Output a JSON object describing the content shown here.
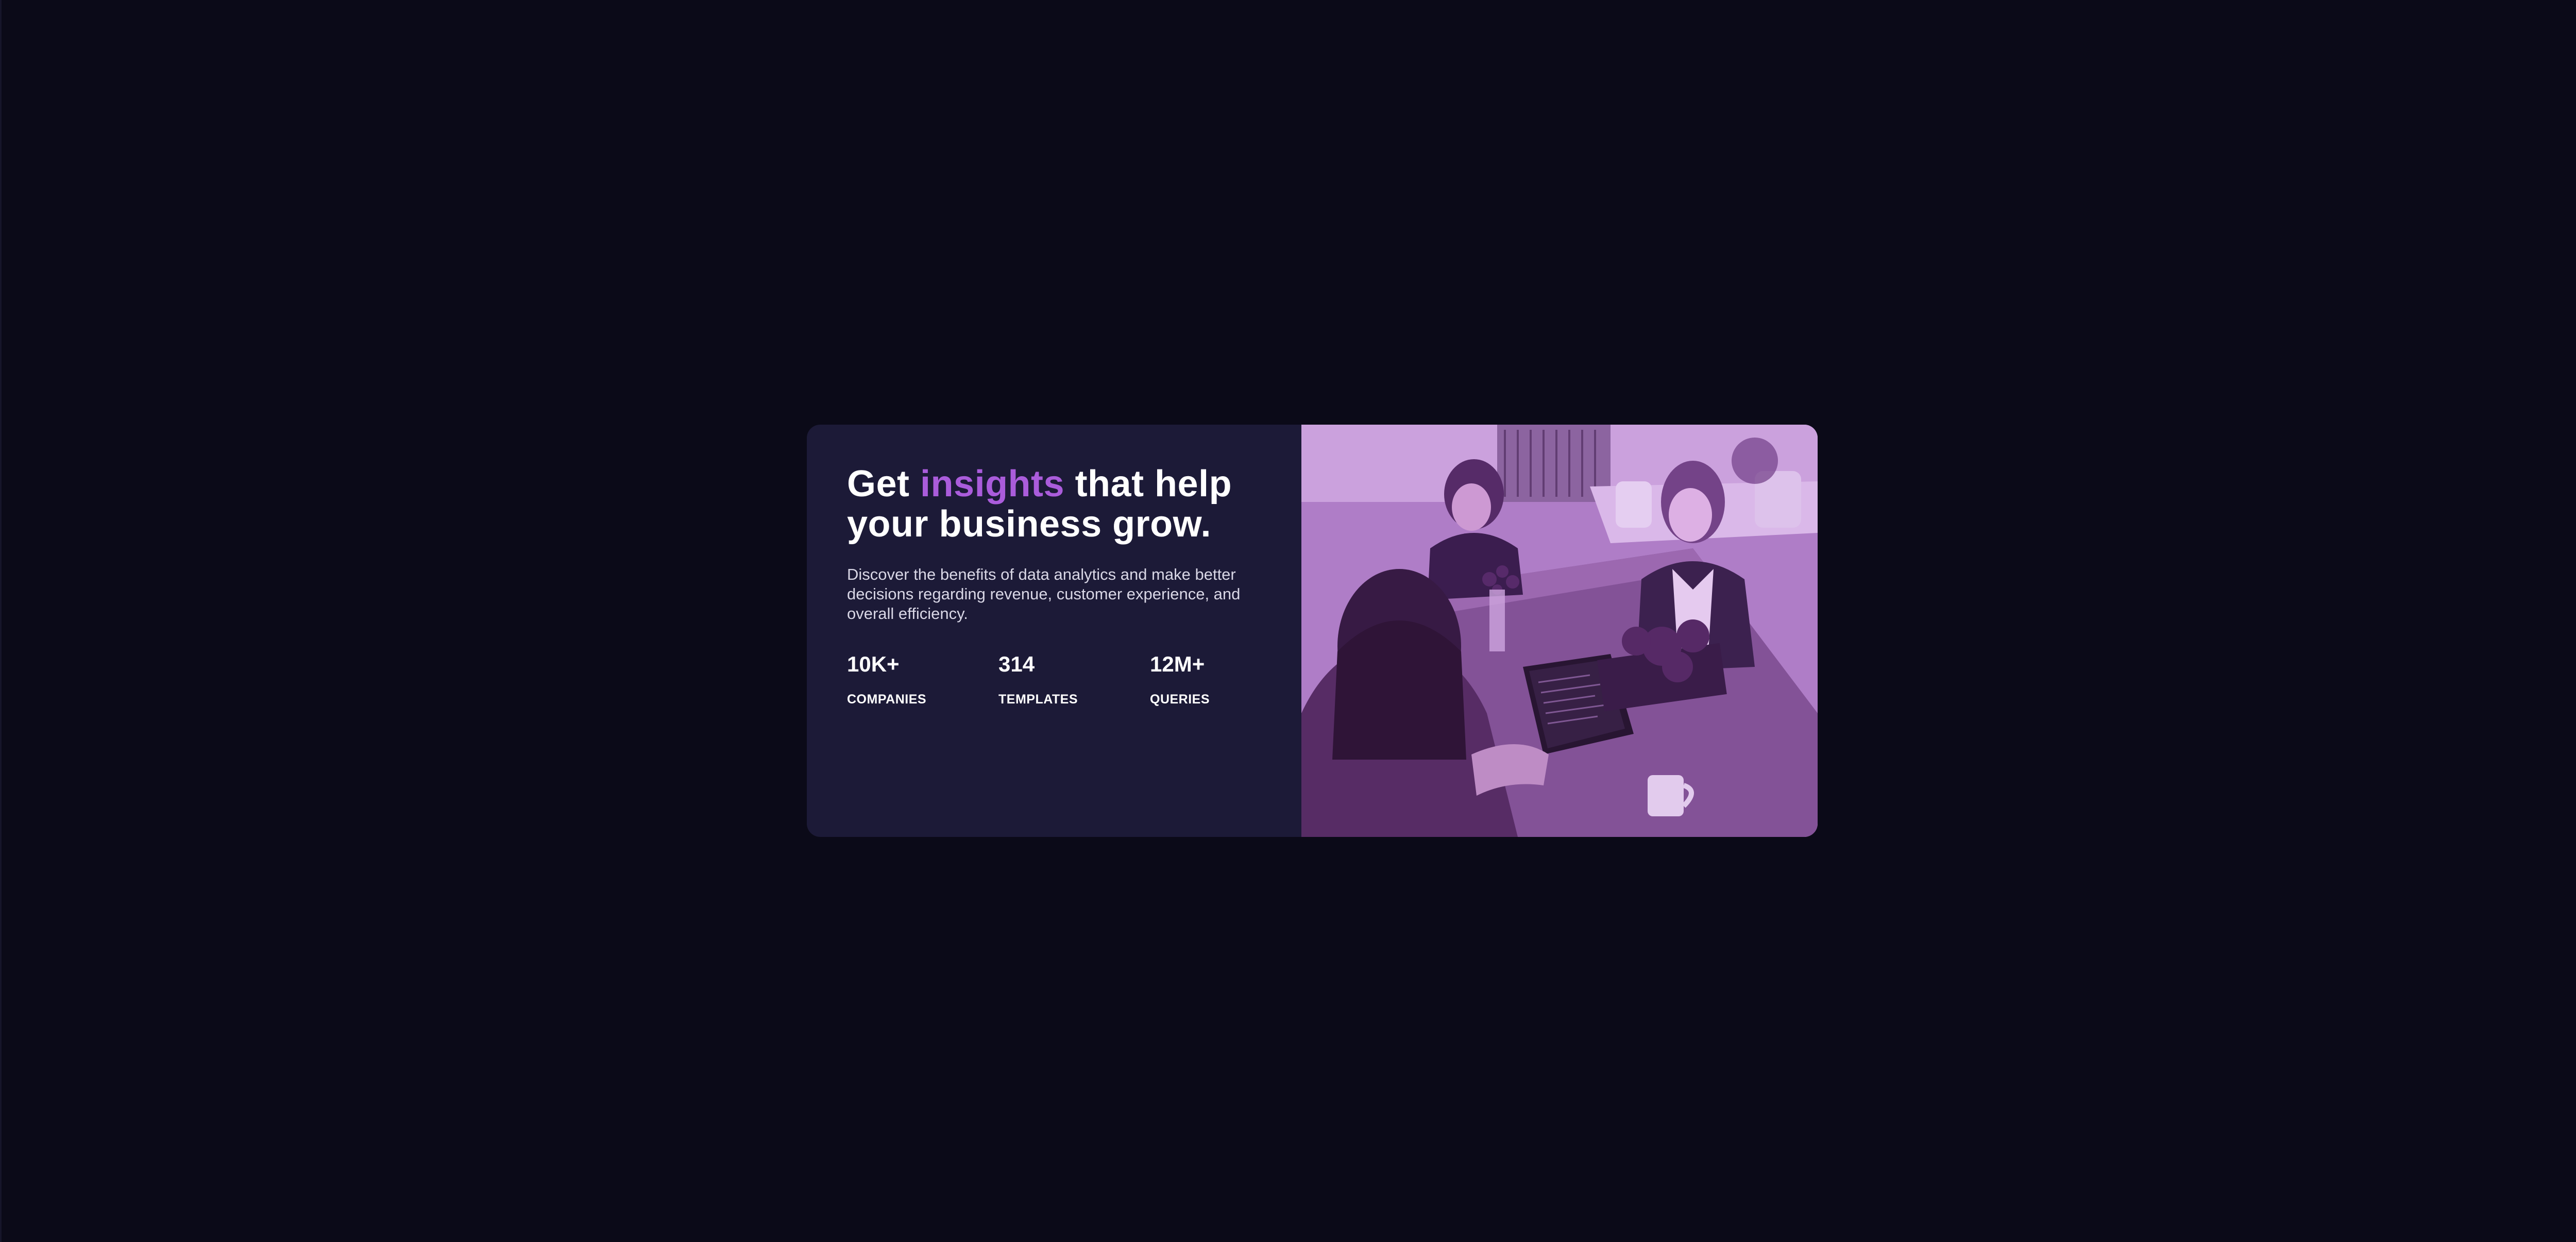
{
  "headline": {
    "before": "Get",
    "accent": "insights",
    "after": "that help your business grow."
  },
  "description": "Discover the benefits of data analytics and make better decisions regarding revenue, customer experience, and overall efficiency.",
  "stats": [
    {
      "value": "10K+",
      "label": "COMPANIES"
    },
    {
      "value": "314",
      "label": "TEMPLATES"
    },
    {
      "value": "12M+",
      "label": "QUERIES"
    }
  ],
  "colors": {
    "page_background": "#0b0a18",
    "card_background": "#1c1a37",
    "accent": "#aa5cdb",
    "heading": "#ffffff",
    "body_text": "#d9d7e6"
  },
  "image": {
    "icon": "office-photo-image"
  }
}
